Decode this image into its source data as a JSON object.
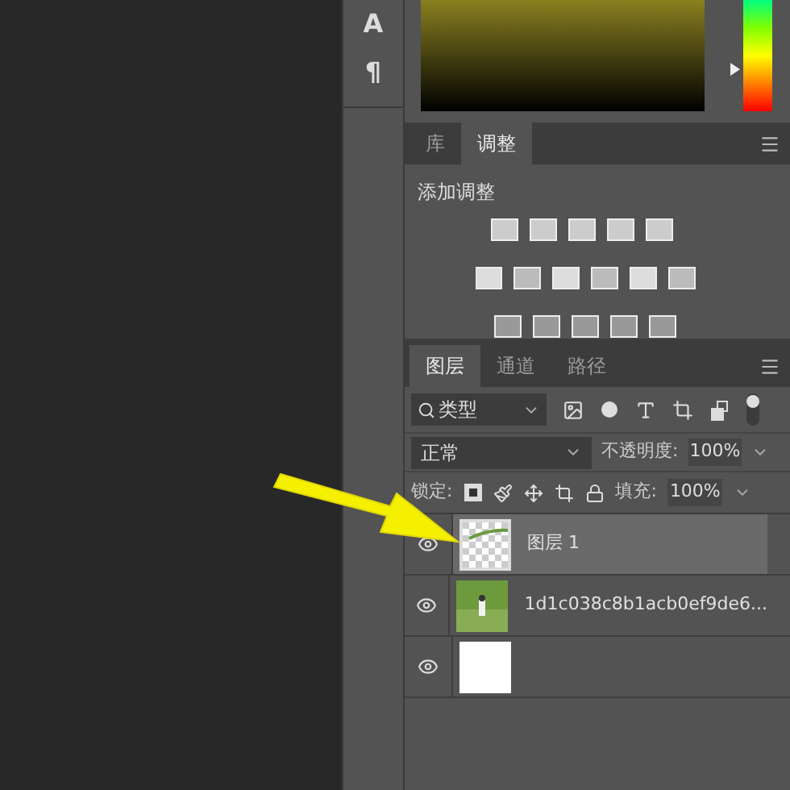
{
  "side_tools": [
    {
      "glyph": "A"
    },
    {
      "glyph": "¶"
    }
  ],
  "hue": {
    "level": 0.38
  },
  "adjust_tabs": [
    {
      "label": "库",
      "selected": false
    },
    {
      "label": "调整",
      "selected": true
    }
  ],
  "adjustments": {
    "title": "添加调整"
  },
  "layer_tabs": [
    {
      "label": "图层",
      "selected": true
    },
    {
      "label": "通道",
      "selected": false
    },
    {
      "label": "路径",
      "selected": false
    }
  ],
  "filter": {
    "value": "类型"
  },
  "blend": {
    "value": "正常"
  },
  "opacity": {
    "label": "不透明度:",
    "value": "100%"
  },
  "lock": {
    "label": "锁定:"
  },
  "fill": {
    "label": "填充:",
    "value": "100%"
  },
  "layers": [
    {
      "name": "图层 1",
      "selected": true,
      "visible": true,
      "kind": "transparent"
    },
    {
      "name": "1d1c038c8b1acb0ef9de6...",
      "selected": false,
      "visible": true
    },
    {
      "selected": false,
      "visible": true,
      "kind": "white"
    }
  ]
}
